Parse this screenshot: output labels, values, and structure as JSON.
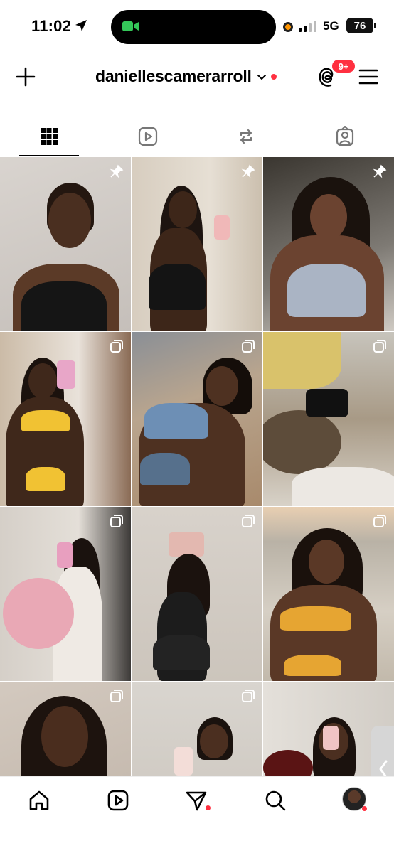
{
  "status": {
    "time": "11:02",
    "network": "5G",
    "battery": "76",
    "icons": [
      "location-arrow-icon",
      "facetime-icon",
      "signal-icon"
    ]
  },
  "header": {
    "username": "daniellescamerarroll",
    "notification_count": "9+",
    "icons": [
      "plus-icon",
      "chevron-down-icon",
      "threads-icon",
      "hamburger-menu-icon"
    ]
  },
  "tabs": [
    {
      "name": "grid",
      "icon": "grid-icon",
      "active": true
    },
    {
      "name": "reels",
      "icon": "reels-icon",
      "active": false
    },
    {
      "name": "reposts",
      "icon": "repost-icon",
      "active": false
    },
    {
      "name": "tagged",
      "icon": "tagged-icon",
      "active": false
    }
  ],
  "posts": [
    {
      "corner_icon": "pin-icon"
    },
    {
      "corner_icon": "pin-icon"
    },
    {
      "corner_icon": "pin-icon"
    },
    {
      "corner_icon": "carousel-icon"
    },
    {
      "corner_icon": "carousel-icon"
    },
    {
      "corner_icon": "carousel-icon"
    },
    {
      "corner_icon": "carousel-icon"
    },
    {
      "corner_icon": "carousel-icon"
    },
    {
      "corner_icon": "carousel-icon"
    },
    {
      "corner_icon": "carousel-icon"
    },
    {
      "corner_icon": "carousel-icon"
    },
    {
      "corner_icon": "carousel-icon"
    }
  ],
  "bottom_nav": [
    "home-icon",
    "reels-icon",
    "direct-icon",
    "search-icon",
    "profile-avatar"
  ],
  "colors": {
    "accent_red": "#ff3040",
    "text": "#000000",
    "background": "#ffffff"
  }
}
